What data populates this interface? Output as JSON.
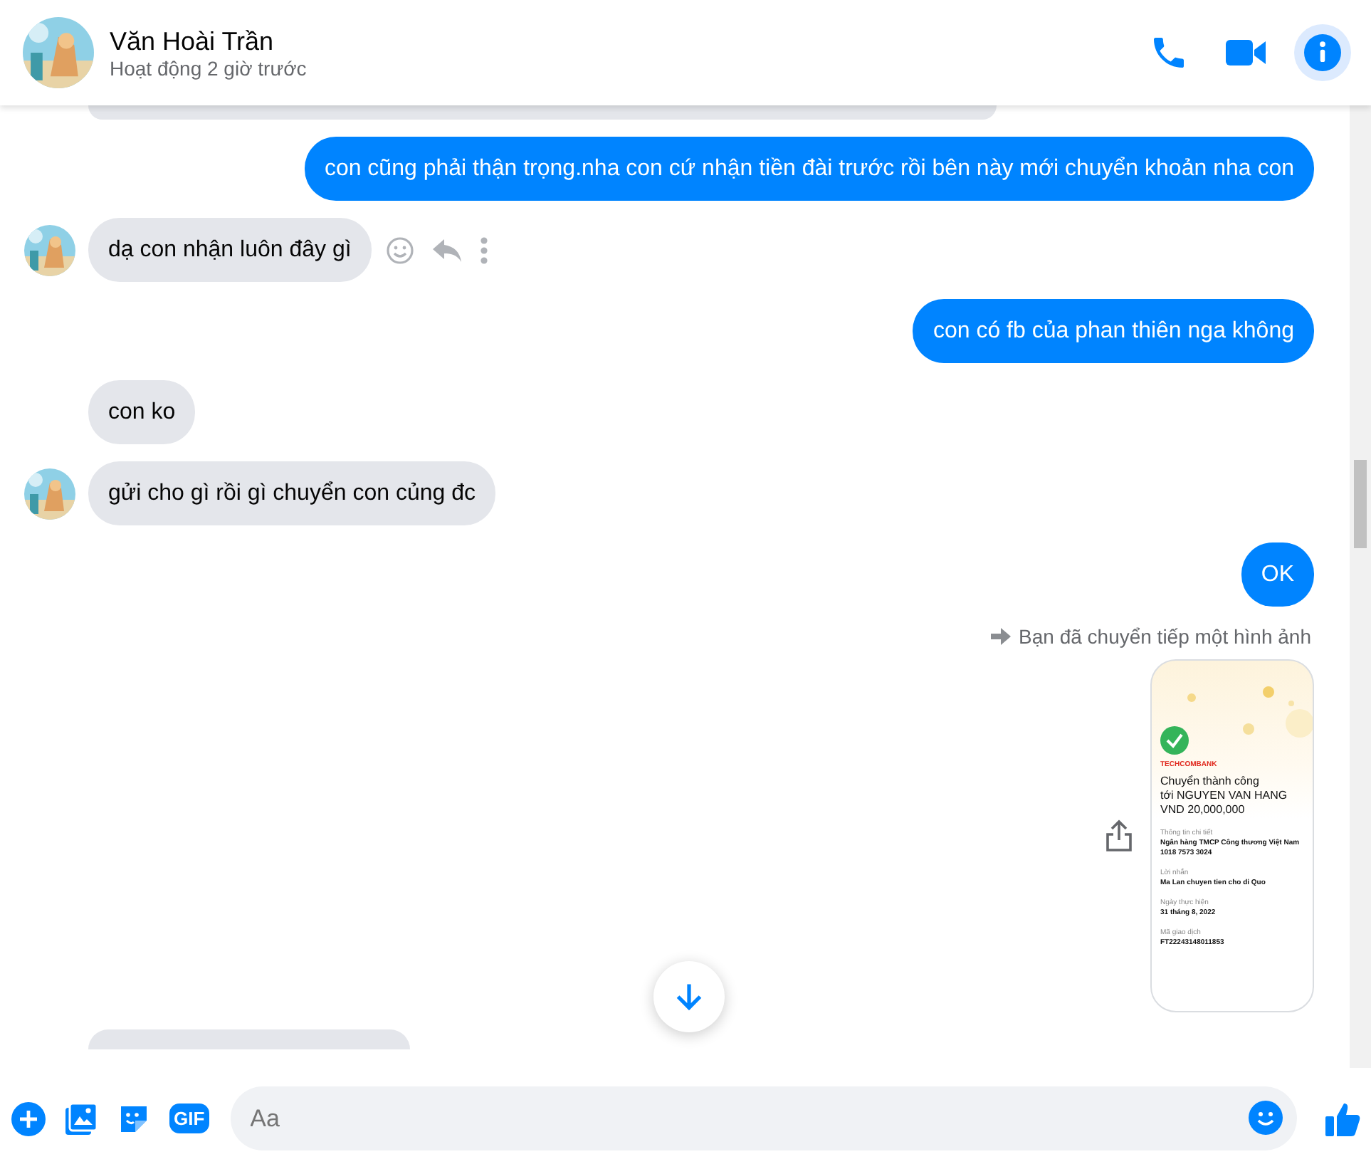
{
  "header": {
    "name": "Văn Hoài Trần",
    "status": "Hoạt động 2 giờ trước",
    "actions": [
      {
        "kind": "phone",
        "selected": false
      },
      {
        "kind": "video",
        "selected": false
      },
      {
        "kind": "info",
        "selected": true
      }
    ]
  },
  "messages": [
    {
      "kind": "partial_received_top"
    },
    {
      "kind": "sent",
      "text": "con cũng phải thận trọng.nha con cứ nhận tiền đài trước rồi bên này mới chuyển khoản nha con"
    },
    {
      "kind": "received",
      "text": "dạ con nhận luôn đây gì",
      "avatar": true,
      "hovered": true
    },
    {
      "kind": "sent",
      "text": "con có fb của phan thiên nga không"
    },
    {
      "kind": "received",
      "text": "con ko",
      "avatar": false,
      "hovered": false
    },
    {
      "kind": "received",
      "text": "gửi cho gì rồi gì chuyển con củng đc",
      "avatar": true,
      "hovered": false
    },
    {
      "kind": "sent",
      "text": "OK"
    },
    {
      "kind": "forwarded_image",
      "label": "Bạn đã chuyển tiếp một hình ảnh",
      "receipt": {
        "bank": "TECHCOMBANK",
        "title": "Chuyển thành công",
        "recipient": "tới NGUYEN VAN HANG",
        "amount": "VND 20,000,000",
        "fields": [
          {
            "label": "Thông tin chi tiết",
            "value": "Ngân hàng TMCP Công thương Việt Nam",
            "value_2": "1018 7573 3024"
          },
          {
            "label": "Lời nhắn",
            "value": "Ma Lan chuyen tien cho di Quo"
          },
          {
            "label": "Ngày thực hiện",
            "value": "31 tháng 8, 2022"
          },
          {
            "label": "Mã giao dịch",
            "value": "FT22243148011853"
          }
        ]
      }
    },
    {
      "kind": "partial_received_bottom"
    }
  ],
  "composer": {
    "placeholder": "Aa",
    "gif_label": "GIF"
  }
}
